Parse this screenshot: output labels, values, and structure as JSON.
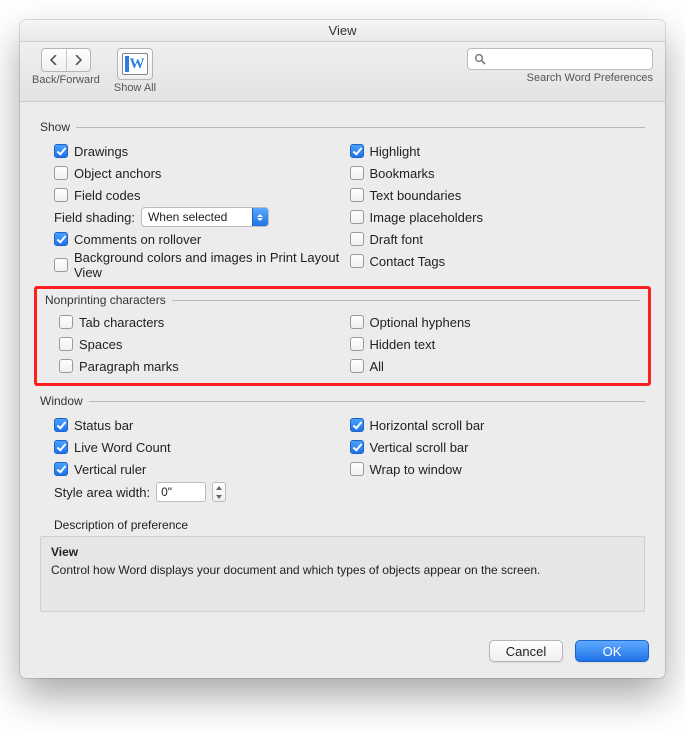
{
  "window": {
    "title": "View"
  },
  "toolbar": {
    "backforward_label": "Back/Forward",
    "showall_label": "Show All",
    "search_label": "Search Word Preferences",
    "search_placeholder": ""
  },
  "sections": {
    "show": {
      "title": "Show",
      "left": [
        {
          "label": "Drawings",
          "checked": true
        },
        {
          "label": "Object anchors",
          "checked": false
        },
        {
          "label": "Field codes",
          "checked": false
        }
      ],
      "field_shading_label": "Field shading:",
      "field_shading_value": "When selected",
      "left2": [
        {
          "label": "Comments on rollover",
          "checked": true
        },
        {
          "label": "Background colors and images in Print Layout View",
          "checked": false
        }
      ],
      "right": [
        {
          "label": "Highlight",
          "checked": true
        },
        {
          "label": "Bookmarks",
          "checked": false
        },
        {
          "label": "Text boundaries",
          "checked": false
        },
        {
          "label": "Image placeholders",
          "checked": false
        },
        {
          "label": "Draft font",
          "checked": false
        },
        {
          "label": "Contact Tags",
          "checked": false
        }
      ]
    },
    "nonprinting": {
      "title": "Nonprinting characters",
      "left": [
        {
          "label": "Tab characters",
          "checked": false
        },
        {
          "label": "Spaces",
          "checked": false
        },
        {
          "label": "Paragraph marks",
          "checked": false
        }
      ],
      "right": [
        {
          "label": "Optional hyphens",
          "checked": false
        },
        {
          "label": "Hidden text",
          "checked": false
        },
        {
          "label": "All",
          "checked": false
        }
      ]
    },
    "window_sec": {
      "title": "Window",
      "left": [
        {
          "label": "Status bar",
          "checked": true
        },
        {
          "label": "Live Word Count",
          "checked": true
        },
        {
          "label": "Vertical ruler",
          "checked": true
        }
      ],
      "style_area_label": "Style area width:",
      "style_area_value": "0\"",
      "right": [
        {
          "label": "Horizontal scroll bar",
          "checked": true
        },
        {
          "label": "Vertical scroll bar",
          "checked": true
        },
        {
          "label": "Wrap to window",
          "checked": false
        }
      ]
    }
  },
  "description": {
    "heading": "Description of preference",
    "title": "View",
    "body": "Control how Word displays your document and which types of objects appear on the screen."
  },
  "footer": {
    "cancel": "Cancel",
    "ok": "OK"
  }
}
